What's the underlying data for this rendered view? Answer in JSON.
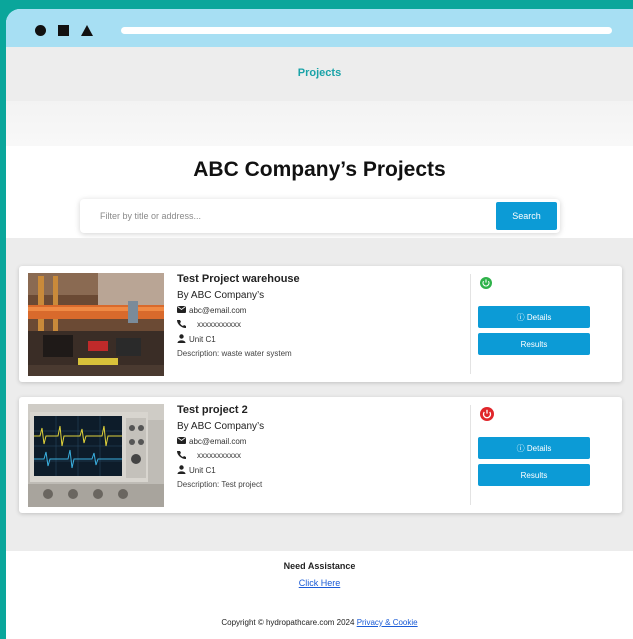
{
  "nav": {
    "projects_label": "Projects"
  },
  "hero": {
    "title": "ABC Company’s Projects"
  },
  "search": {
    "placeholder": "Filter by title or address...",
    "button_label": "Search"
  },
  "projects": [
    {
      "title": "Test Project warehouse",
      "by_prefix": "By",
      "company": "ABC Company’s",
      "email": "abc@email.com",
      "phone": "xxxxxxxxxxx",
      "unit": "Unit C1",
      "description": "Description: waste water system",
      "status": "active",
      "status_color": "#2fb24a",
      "details_label": "ⓘ Details",
      "results_label": "Results",
      "thumb_icon": "warehouse-pipes-photo"
    },
    {
      "title": "Test project 2",
      "by_prefix": "By",
      "company": "ABC Company’s",
      "email": "abc@email.com",
      "phone": "xxxxxxxxxxx",
      "unit": "Unit C1",
      "description": "Description: Test project",
      "status": "inactive",
      "status_color": "#e0262b",
      "details_label": "ⓘ Details",
      "results_label": "Results",
      "thumb_icon": "oscilloscope-photo"
    }
  ],
  "footer": {
    "need_assistance": "Need Assistance",
    "click_here": "Click Here",
    "copyright": "Copyright © hydropathcare.com 2024",
    "privacy_link": "Privacy & Cookie"
  },
  "colors": {
    "accent": "#0c9bd6",
    "frame": "#0aa69b",
    "titlebar": "#a7dff3",
    "nav_text": "#1aa3a8"
  }
}
